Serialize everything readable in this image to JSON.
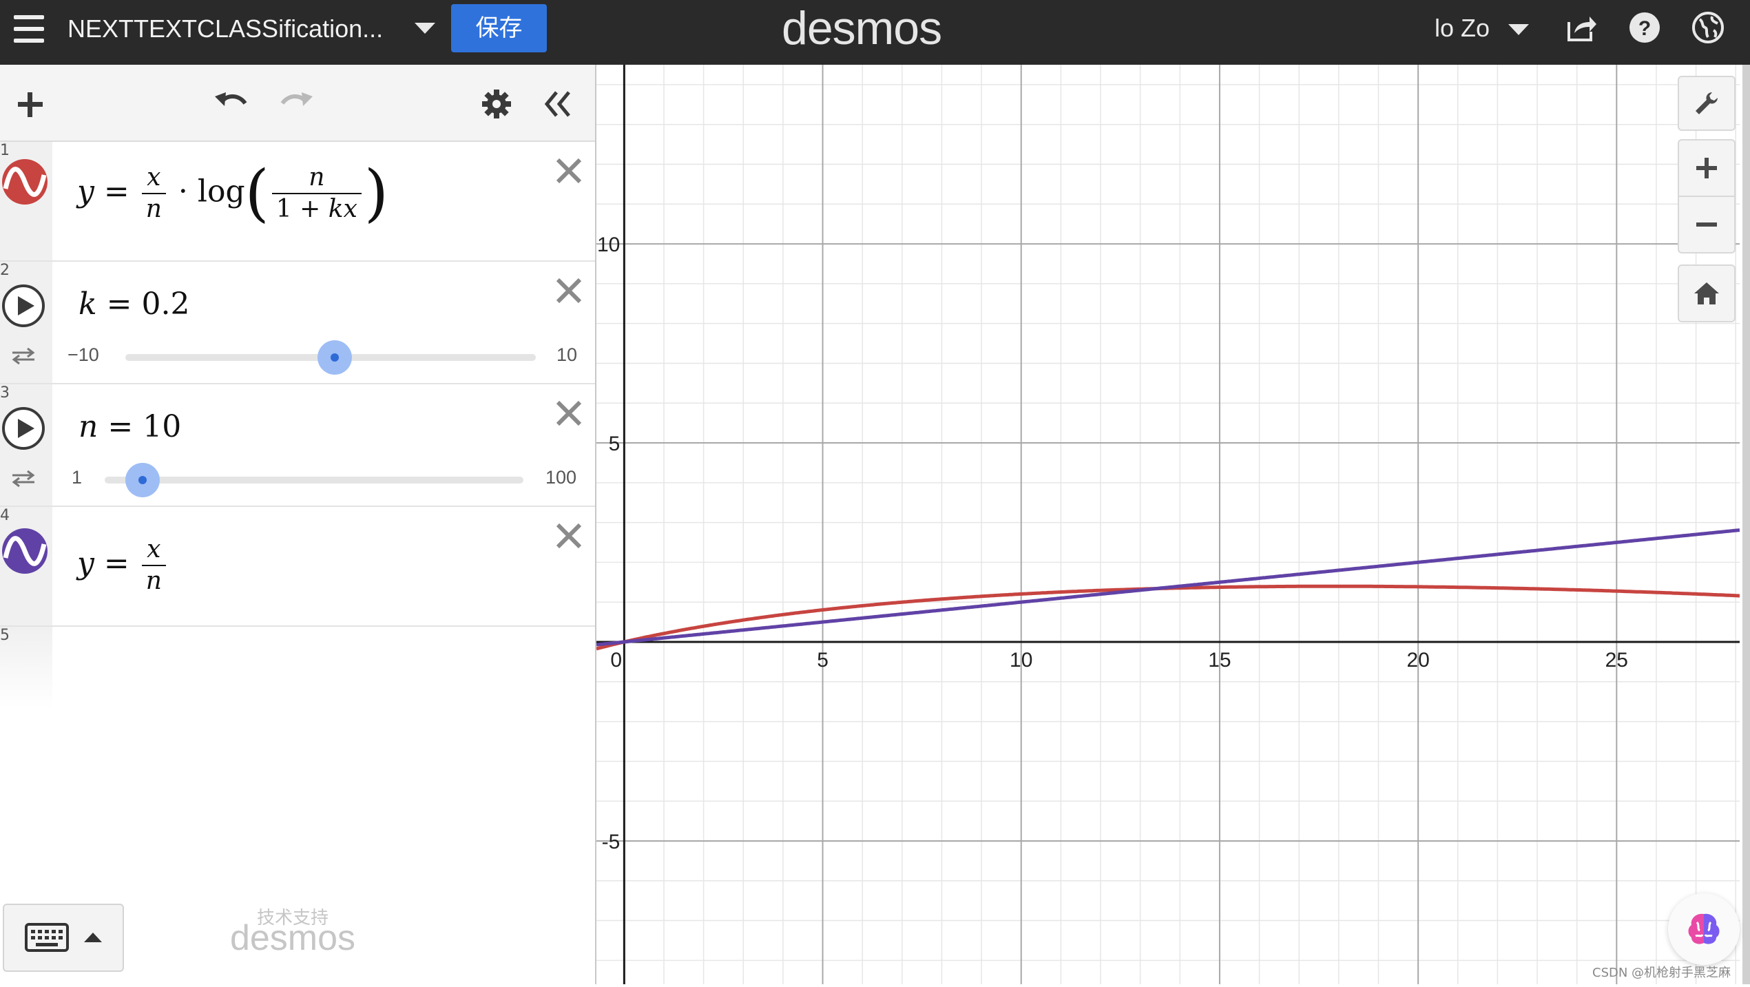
{
  "topbar": {
    "doc_title": "NEXTTEXTCLASSification...",
    "save_label": "保存",
    "brand": "desmos",
    "user_name": "lo Zo",
    "icons": [
      "menu-icon",
      "chevron-down-icon",
      "share-icon",
      "help-icon",
      "language-globe-icon"
    ]
  },
  "toolbar": {
    "icons": [
      "plus-icon",
      "undo-icon",
      "redo-icon",
      "gear-icon",
      "collapse-double-chevron-icon"
    ]
  },
  "expressions": [
    {
      "num": "1",
      "type": "equation",
      "color": "#c74440",
      "latex": "y=\\frac{x}{n}\\cdot\\log\\left(\\frac{n}{1+kx}\\right)",
      "lhs": "y",
      "eq": "=",
      "frac_num": "x",
      "frac_den": "n",
      "dot": "·",
      "fn": "log",
      "inner_num": "n",
      "inner_den_1": "1 + ",
      "inner_den_2": "kx"
    },
    {
      "num": "2",
      "type": "slider",
      "var": "k",
      "eq": "=",
      "value": "0.2",
      "min": "−10",
      "max": "10",
      "numeric_value": 0.2,
      "range": [
        -10,
        10
      ]
    },
    {
      "num": "3",
      "type": "slider",
      "var": "n",
      "eq": "=",
      "value": "10",
      "min": "1",
      "max": "100",
      "numeric_value": 10,
      "range": [
        1,
        100
      ]
    },
    {
      "num": "4",
      "type": "equation",
      "color": "#6042a6",
      "latex": "y=\\frac{x}{n}",
      "lhs": "y",
      "eq": "=",
      "frac_num": "x",
      "frac_den": "n"
    },
    {
      "num": "5",
      "type": "empty"
    }
  ],
  "footer": {
    "powered_by": "技术支持",
    "powered_brand": "desmos"
  },
  "graph": {
    "x_range": [
      -0.7,
      28.1
    ],
    "y_range": [
      -8.6,
      14.5
    ],
    "x_ticks": [
      "0",
      "5",
      "10",
      "15",
      "20",
      "25"
    ],
    "y_ticks": [
      "10",
      "5",
      "-5"
    ],
    "grid": true,
    "controls": [
      "wrench-icon",
      "zoom-in-icon",
      "zoom-out-icon",
      "home-icon"
    ]
  },
  "chart_data": {
    "type": "line",
    "xlabel": "",
    "ylabel": "",
    "xlim": [
      -0.7,
      28.1
    ],
    "ylim": [
      -8.6,
      14.5
    ],
    "series": [
      {
        "color": "#c74440",
        "function": "y=(x/n)*ln(n/(1+k*x))",
        "k": 0.2,
        "n": 10
      },
      {
        "color": "#6042a6",
        "function": "y=x/n",
        "n": 10
      }
    ]
  },
  "watermark": "CSDN @机枪射手黑芝麻"
}
